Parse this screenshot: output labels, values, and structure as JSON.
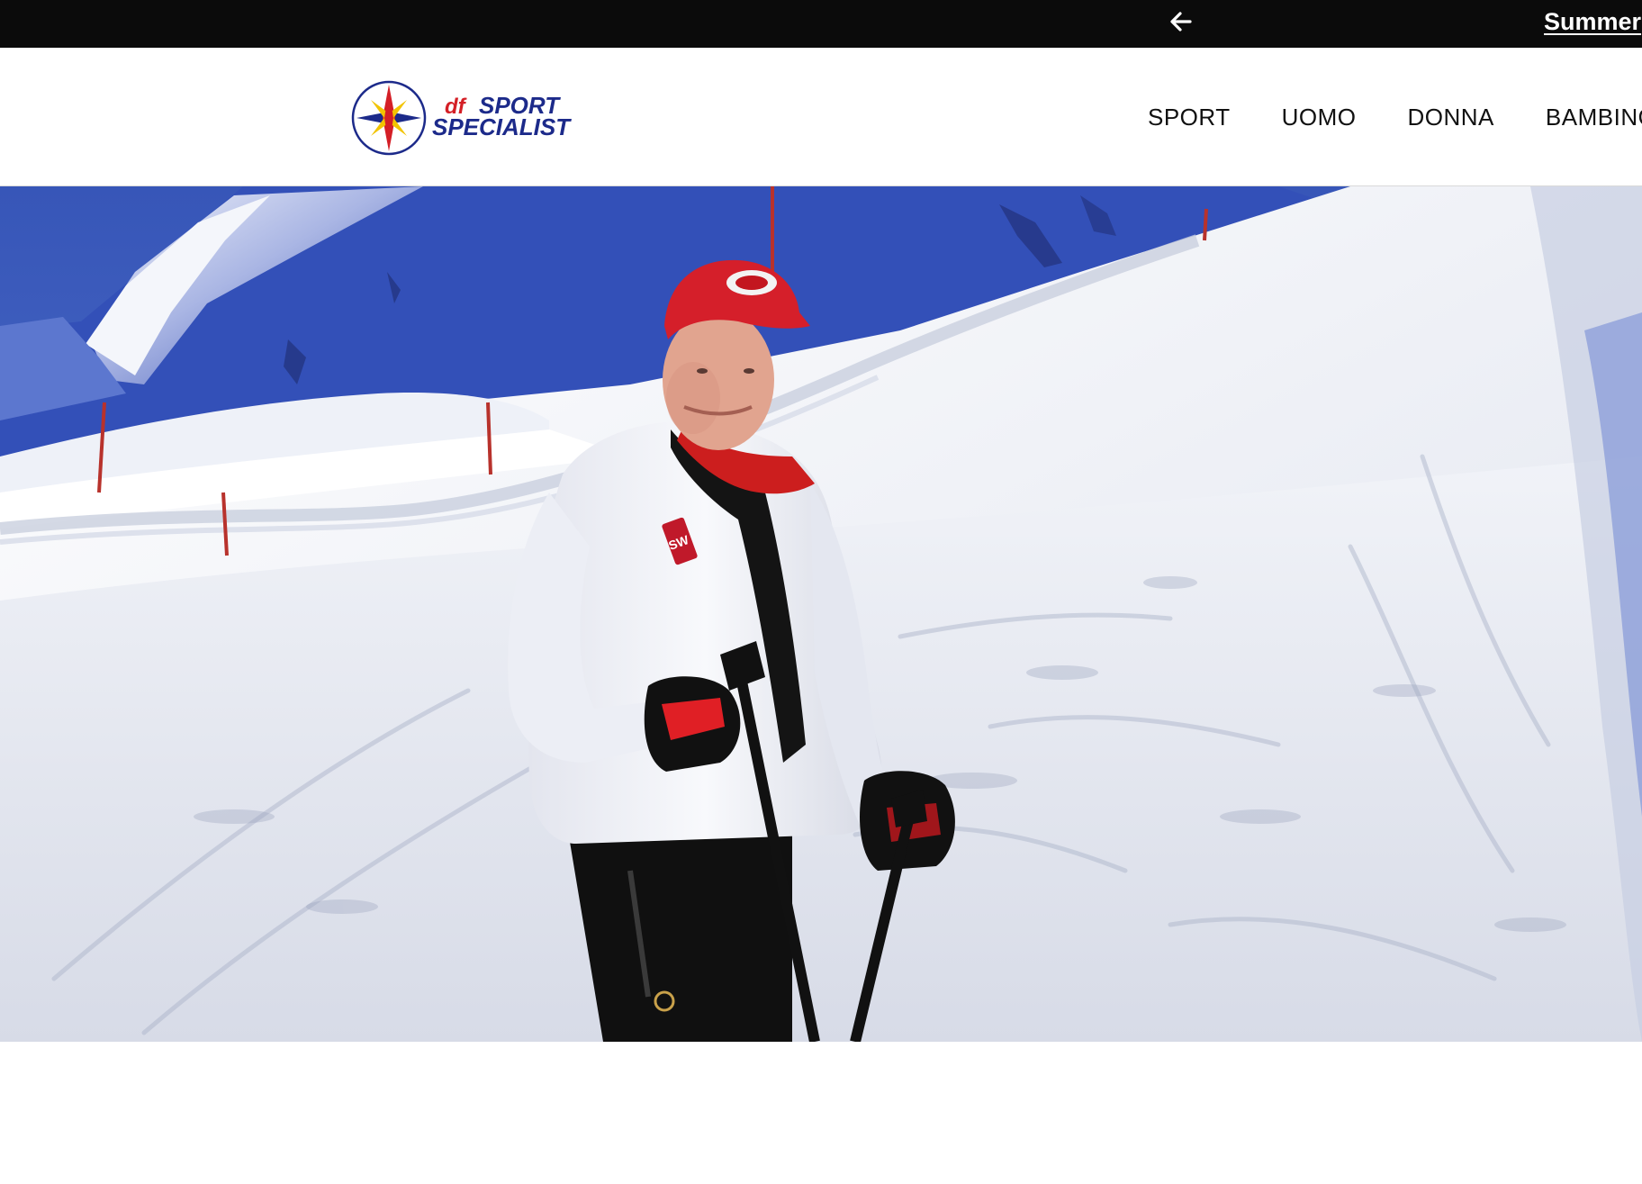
{
  "promo_bar": {
    "arrow_icon": "arrow-left-icon",
    "text": "Summer"
  },
  "header": {
    "logo": {
      "prefix": "df",
      "line1": "SPORT",
      "line2": "SPECIALIST",
      "colors": {
        "navy": "#1c2a8a",
        "red": "#d41f26",
        "yellow": "#f2c400"
      }
    },
    "nav": [
      {
        "label": "SPORT"
      },
      {
        "label": "UOMO"
      },
      {
        "label": "DONNA"
      },
      {
        "label": "BAMBINO"
      }
    ]
  },
  "hero": {
    "scene": "hero-image",
    "colors": {
      "sky": "#3f63c7",
      "snow": "#e9ecf4",
      "cap": "#d51f2a",
      "jacket": "#f2f3f7",
      "pants": "#111111"
    }
  },
  "colors": {
    "promo_bg": "#0b0b0b",
    "header_bg": "#ffffff",
    "nav_text": "#111111"
  }
}
